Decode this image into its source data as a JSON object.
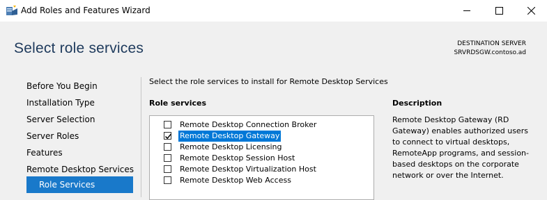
{
  "window": {
    "title": "Add Roles and Features Wizard",
    "controls": [
      "minimize",
      "maximize",
      "close"
    ]
  },
  "header": {
    "page_title": "Select role services",
    "destination_label": "DESTINATION SERVER",
    "destination_server": "SRVRDSGW.contoso.ad"
  },
  "nav": {
    "items": [
      {
        "label": "Before You Begin"
      },
      {
        "label": "Installation Type"
      },
      {
        "label": "Server Selection"
      },
      {
        "label": "Server Roles"
      },
      {
        "label": "Features"
      },
      {
        "label": "Remote Desktop Services"
      },
      {
        "label": "Role Services",
        "active": true
      }
    ]
  },
  "main": {
    "instruction": "Select the role services to install for Remote Desktop Services",
    "role_services_heading": "Role services",
    "role_services": [
      {
        "label": "Remote Desktop Connection Broker",
        "checked": false,
        "selected": false
      },
      {
        "label": "Remote Desktop Gateway",
        "checked": true,
        "selected": true
      },
      {
        "label": "Remote Desktop Licensing",
        "checked": false,
        "selected": false
      },
      {
        "label": "Remote Desktop Session Host",
        "checked": false,
        "selected": false
      },
      {
        "label": "Remote Desktop Virtualization Host",
        "checked": false,
        "selected": false
      },
      {
        "label": "Remote Desktop Web Access",
        "checked": false,
        "selected": false
      }
    ],
    "description_heading": "Description",
    "description": "Remote Desktop Gateway (RD Gateway) enables authorized users to connect to virtual desktops, RemoteApp programs, and session-based desktops on the corporate network or over the Internet."
  },
  "colors": {
    "accent": "#1979ca",
    "selection": "#0078d7",
    "title_text": "#1e3a5c"
  }
}
